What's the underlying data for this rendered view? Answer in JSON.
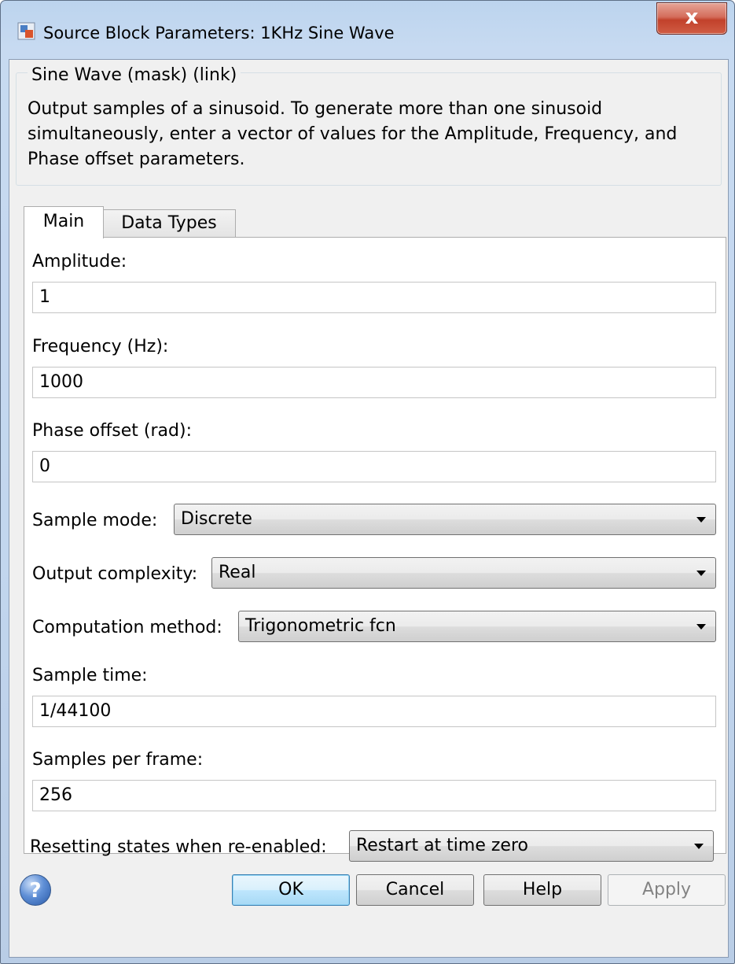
{
  "window": {
    "title": "Source Block Parameters: 1KHz Sine Wave",
    "close_label": "x"
  },
  "description": {
    "legend": "Sine Wave (mask) (link)",
    "text": "Output samples of a sinusoid.  To generate more than one sinusoid simultaneously, enter a vector of values for the Amplitude, Frequency, and Phase offset parameters."
  },
  "tabs": [
    {
      "label": "Main",
      "selected": true
    },
    {
      "label": "Data Types",
      "selected": false
    }
  ],
  "params": {
    "amplitude": {
      "label": "Amplitude:",
      "value": "1"
    },
    "frequency": {
      "label": "Frequency (Hz):",
      "value": "1000"
    },
    "phase": {
      "label": "Phase offset (rad):",
      "value": "0"
    },
    "sample_mode": {
      "label": "Sample mode:",
      "value": "Discrete"
    },
    "output_complexity": {
      "label": "Output complexity:",
      "value": "Real"
    },
    "computation_method": {
      "label": "Computation method:",
      "value": "Trigonometric fcn"
    },
    "sample_time": {
      "label": "Sample time:",
      "value": "1/44100"
    },
    "samples_per_frame": {
      "label": "Samples per frame:",
      "value": "256"
    },
    "resetting_states": {
      "label": "Resetting states when re-enabled:",
      "value": "Restart at time zero"
    }
  },
  "buttons": {
    "help_icon": "?",
    "ok": "OK",
    "cancel": "Cancel",
    "help": "Help",
    "apply": "Apply"
  },
  "colors": {
    "frame": "#c2d6ee",
    "close_button": "#c2412b",
    "default_button_border": "#3c7fb1"
  },
  "icons": [
    "simulink-block-icon",
    "close-icon",
    "help-icon",
    "dropdown-arrow-icon"
  ]
}
